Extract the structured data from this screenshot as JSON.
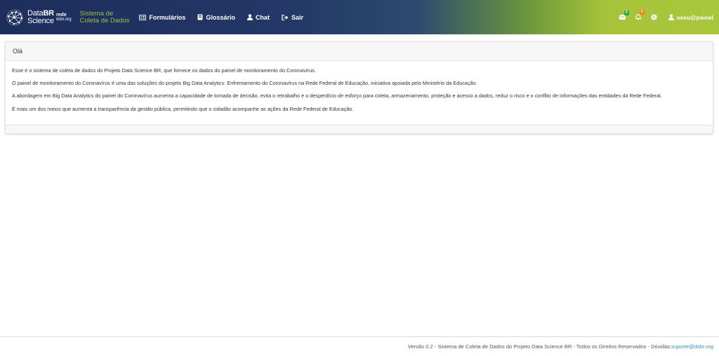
{
  "navbar": {
    "brand": {
      "line1_a": "Data",
      "line1_b": "BR",
      "line2": "Science",
      "rede": "rede",
      "domain": "dsbr.org"
    },
    "system_title": {
      "line1": "Sistema de",
      "line2": "Coleta de Dados"
    },
    "menu": [
      {
        "label": "Formulários",
        "icon": "form-icon"
      },
      {
        "label": "Glossário",
        "icon": "book-icon"
      },
      {
        "label": "Chat",
        "icon": "user-icon"
      },
      {
        "label": "Sair",
        "icon": "logout-icon"
      }
    ],
    "messages_badge": "0",
    "notifications_badge": "0",
    "user": "sesu@painel",
    "colors": {
      "accent_green": "#9cc23a",
      "dark_blue": "#1d2d5c"
    }
  },
  "card": {
    "title": "Olá",
    "paragraphs": [
      "Esse é o sistema de coleta de dados do Projeto Data Science BR, que fornece os dados do painel de monitoramento do Coronavírus.",
      "O painel de monitoramento do Coronavírus é uma das soluções do projeto Big Data Analytics: Enfrentamento do Coronavírus na Rede Federal de Educação, iniciativa apoiada pelo Ministério da Educação",
      "A abordagem em Big Data Analytics do painel do Coronavírus aumenta a capacidade de tomada de decisão, evita o retrabalho e o desperdício de esforço para coleta, armazenamento, proteção e acesso a dados, reduz o risco e o conflito de informações das entidades da Rede Federal.",
      "É mais um dos meios que aumenta a transparência da gestão pública, permitindo que o cidadão acompanhe as ações da Rede Federal de Educação."
    ]
  },
  "footer": {
    "text": "Versão 0.2 - Sistema de Coleta de Dados do Projeto Data Science BR - Todos os Direitos Reservados - Dúvidas: ",
    "email": "suporte@dsbr.org"
  }
}
